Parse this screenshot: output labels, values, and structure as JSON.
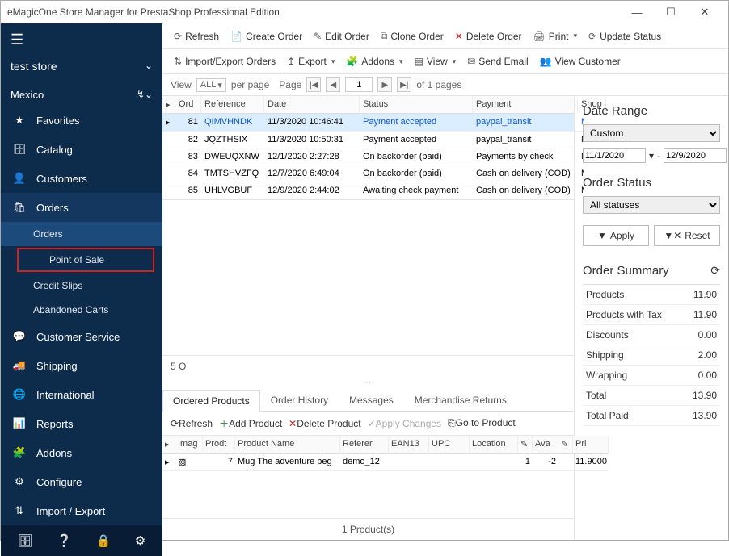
{
  "title": "eMagicOne Store Manager for PrestaShop Professional Edition",
  "store": {
    "name": "test store",
    "country": "Mexico"
  },
  "sidebar": {
    "favorites": "Favorites",
    "catalog": "Catalog",
    "customers": "Customers",
    "orders": "Orders",
    "orders_sub": "Orders",
    "point_of_sale": "Point of Sale",
    "credit_slips": "Credit Slips",
    "abandoned_carts": "Abandoned Carts",
    "customer_service": "Customer Service",
    "shipping": "Shipping",
    "international": "International",
    "reports": "Reports",
    "addons": "Addons",
    "configure": "Configure",
    "import_export": "Import / Export"
  },
  "toolbar1": {
    "refresh": "Refresh",
    "create_order": "Create Order",
    "edit_order": "Edit Order",
    "clone_order": "Clone Order",
    "delete_order": "Delete Order",
    "print": "Print",
    "update_status": "Update Status"
  },
  "toolbar2": {
    "import_export_orders": "Import/Export Orders",
    "export": "Export",
    "addons": "Addons",
    "view": "View",
    "send_email": "Send Email",
    "view_customer": "View Customer"
  },
  "pager": {
    "view_label": "View",
    "all": "ALL",
    "per_page": "per page",
    "page_label": "Page",
    "page_value": "1",
    "of_pages": "of 1 pages"
  },
  "grid_headers": {
    "order": "Ord",
    "reference": "Reference",
    "date": "Date",
    "status": "Status",
    "payment": "Payment",
    "shop": "Shop"
  },
  "orders": [
    {
      "id": "81",
      "ref": "QIMVHNDK",
      "date": "11/3/2020 10:46:41",
      "status": "Payment accepted",
      "payment": "paypal_transit",
      "shop": "Mexico",
      "selected": true
    },
    {
      "id": "82",
      "ref": "JQZTHSIX",
      "date": "11/3/2020 10:50:31",
      "status": "Payment accepted",
      "payment": "paypal_transit",
      "shop": "Mexico"
    },
    {
      "id": "83",
      "ref": "DWEUQXNW",
      "date": "12/1/2020 2:27:28",
      "status": "On backorder (paid)",
      "payment": "Payments by check",
      "shop": "Mexico"
    },
    {
      "id": "84",
      "ref": "TMTSHVZFQ",
      "date": "12/7/2020 6:49:04",
      "status": "On backorder (paid)",
      "payment": "Cash on delivery (COD)",
      "shop": "Mexico"
    },
    {
      "id": "85",
      "ref": "UHLVGBUF",
      "date": "12/9/2020 2:44:02",
      "status": "Awaiting check payment",
      "payment": "Cash on delivery (COD)",
      "shop": "Mexico"
    }
  ],
  "orders_footer": "5 O",
  "subtabs": {
    "ordered_products": "Ordered Products",
    "order_history": "Order History",
    "messages": "Messages",
    "merchandise_returns": "Merchandise Returns"
  },
  "sub_toolbar": {
    "refresh": "Refresh",
    "add_product": "Add Product",
    "delete_product": "Delete Product",
    "apply_changes": "Apply Changes",
    "go_to_product": "Go to Product"
  },
  "pgrid_headers": {
    "imag": "Imag",
    "prod": "Prodt",
    "product_name": "Product Name",
    "referer": "Referer",
    "ean13": "EAN13",
    "upc": "UPC",
    "location": "Location",
    "ava": "Ava",
    "pri": "Pri"
  },
  "product_row": {
    "prod_id": "7",
    "name": "Mug The adventure beg",
    "referer": "demo_12",
    "qty": "1",
    "ava": "-2",
    "price": "11.9000"
  },
  "prod_footer": "1 Product(s)",
  "right": {
    "date_range_title": "Date Range",
    "range_mode": "Custom",
    "date_from": "11/1/2020",
    "date_to": "12/9/2020",
    "order_status_title": "Order Status",
    "all_statuses": "All statuses",
    "apply": "Apply",
    "reset": "Reset",
    "order_summary_title": "Order Summary",
    "summary": [
      {
        "label": "Products",
        "value": "11.90"
      },
      {
        "label": "Products with Tax",
        "value": "11.90"
      },
      {
        "label": "Discounts",
        "value": "0.00"
      },
      {
        "label": "Shipping",
        "value": "2.00"
      },
      {
        "label": "Wrapping",
        "value": "0.00"
      },
      {
        "label": "Total",
        "value": "13.90"
      },
      {
        "label": "Total Paid",
        "value": "13.90"
      }
    ]
  }
}
